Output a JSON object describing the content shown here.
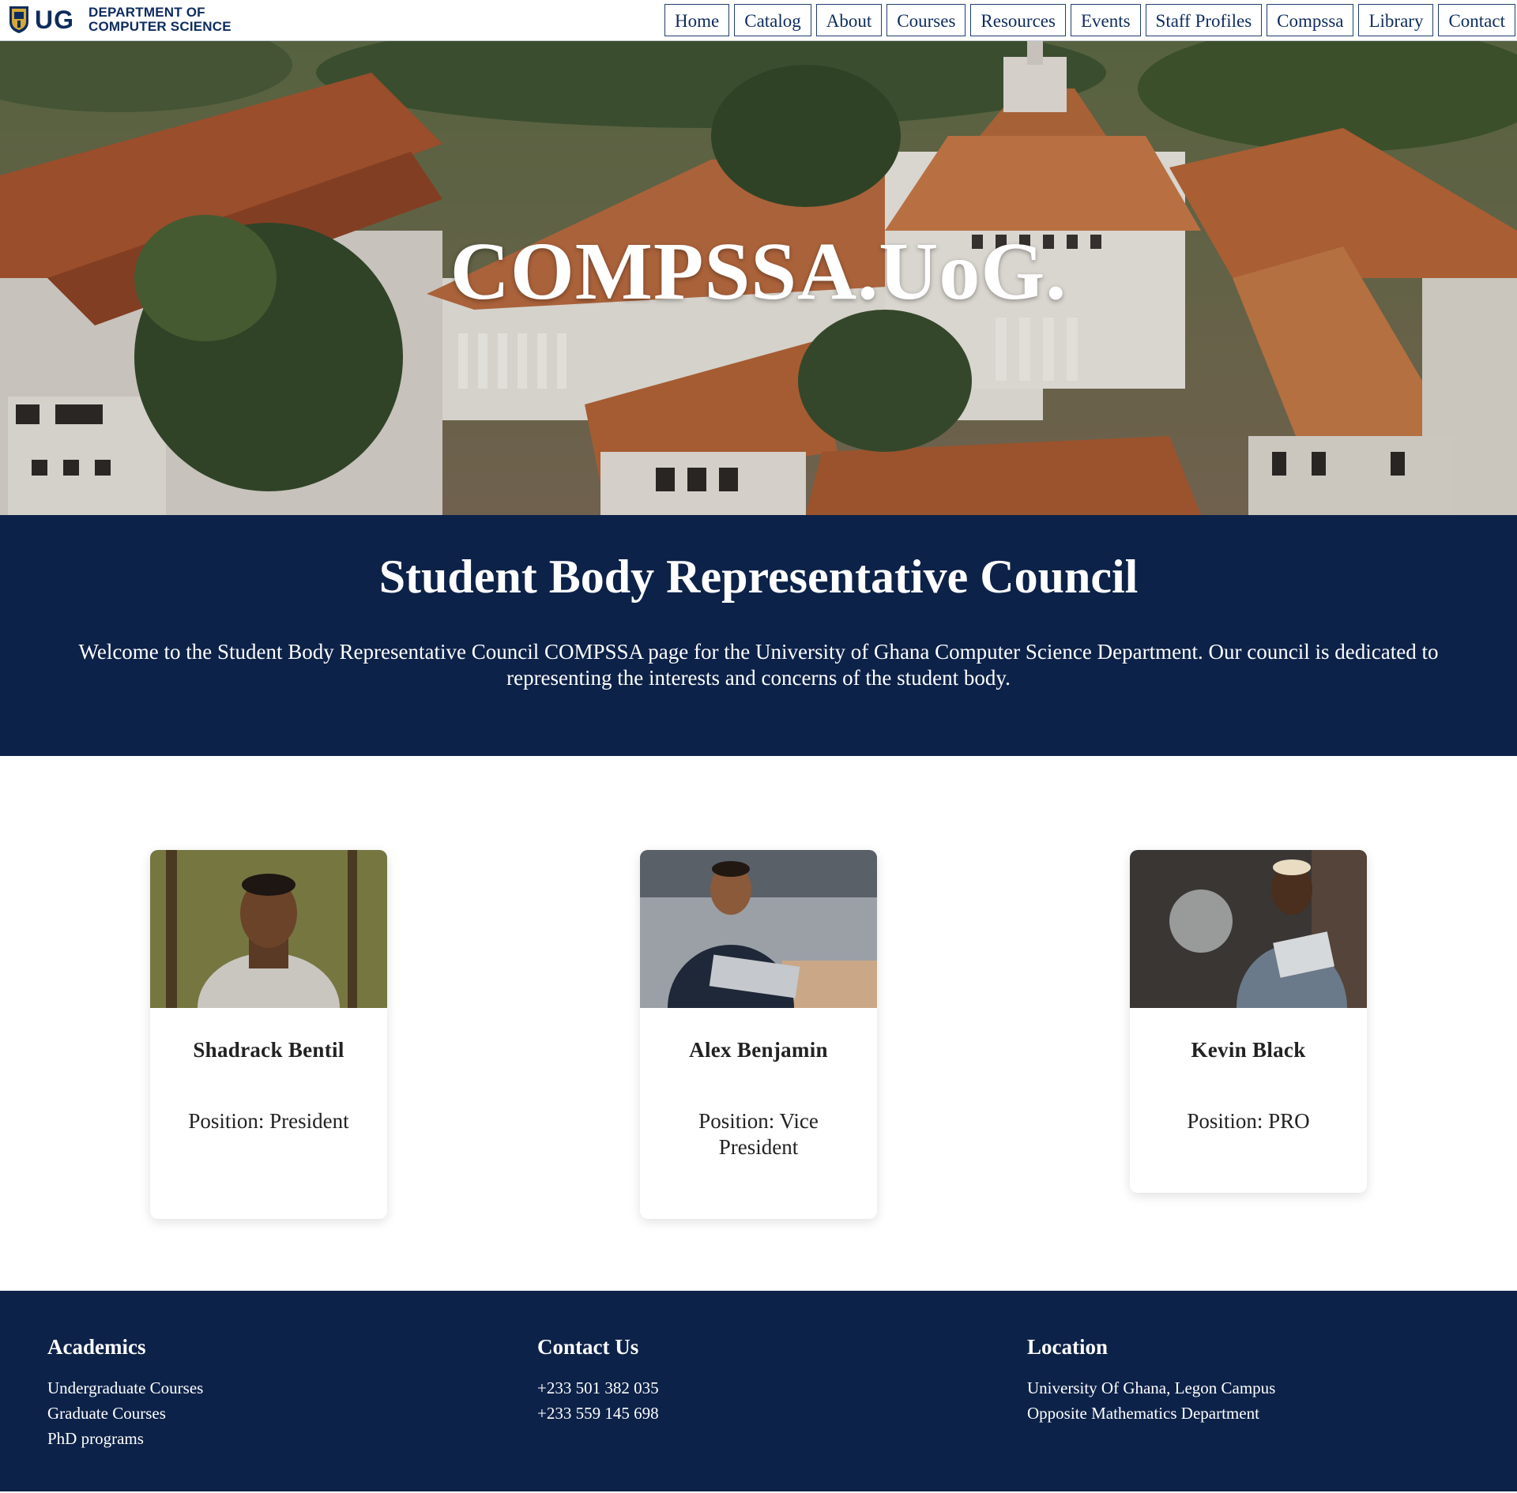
{
  "header": {
    "logo_text": "UG",
    "dept_line1": "DEPARTMENT OF",
    "dept_line2": "COMPUTER SCIENCE",
    "nav": [
      "Home",
      "Catalog",
      "About",
      "Courses",
      "Resources",
      "Events",
      "Staff Profiles",
      "Compssa",
      "Library",
      "Contact"
    ]
  },
  "hero": {
    "title": "COMPSSA.UoG."
  },
  "council": {
    "heading": "Student Body Representative Council",
    "intro": "Welcome to the Student Body Representative Council COMPSSA page for the University of Ghana Computer Science Department. Our council is dedicated to representing the interests and concerns of the student body."
  },
  "members": [
    {
      "name": "Shadrack Bentil",
      "position": "Position: President"
    },
    {
      "name": "Alex Benjamin",
      "position": "Position: Vice President"
    },
    {
      "name": "Kevin Black",
      "position": "Position: PRO"
    }
  ],
  "footer": {
    "academics": {
      "heading": "Academics",
      "items": [
        "Undergraduate Courses",
        "Graduate Courses",
        "PhD programs"
      ]
    },
    "contact": {
      "heading": "Contact Us",
      "items": [
        "+233 501 382 035",
        "+233 559 145 698"
      ]
    },
    "location": {
      "heading": "Location",
      "items": [
        "University Of Ghana, Legon Campus",
        "Opposite Mathematics Department"
      ]
    }
  },
  "colors": {
    "navy": "#0d2249",
    "brand_blue": "#0d2c5e",
    "white": "#ffffff"
  }
}
